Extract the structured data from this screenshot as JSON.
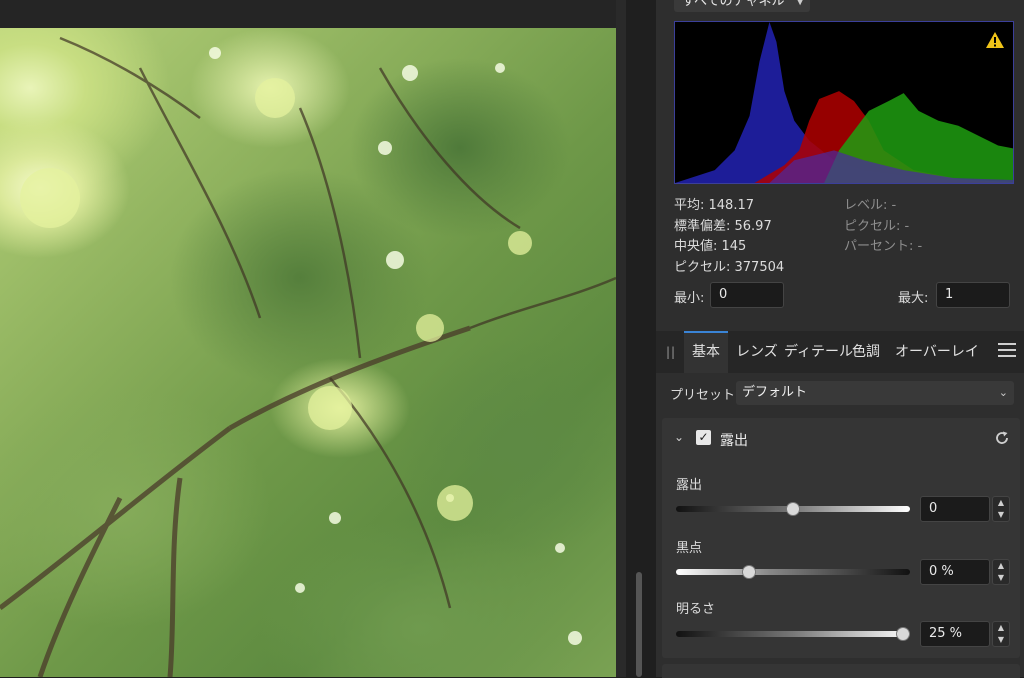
{
  "histogram": {
    "channel": "すべてのチャネル",
    "stats": {
      "mean": "平均: 148.17",
      "std_dev": "標準偏差: 56.97",
      "median": "中央値: 145",
      "pixels": "ピクセル: 377504",
      "level": "レベル: -",
      "pixel_at": "ピクセル: -",
      "percent": "パーセント: -"
    },
    "min_label": "最小:",
    "min_value": "0",
    "max_label": "最大:",
    "max_value": "1"
  },
  "tabs": [
    {
      "label": "基本"
    },
    {
      "label": "レンズ"
    },
    {
      "label": "ディテール"
    },
    {
      "label": "色調"
    },
    {
      "label": "オーバーレイ"
    }
  ],
  "preset": {
    "label": "プリセット:",
    "value": "デフォルト"
  },
  "exposure_group": {
    "title": "露出",
    "sliders": [
      {
        "label": "露出",
        "value": "0",
        "level": 0.5
      },
      {
        "label": "黒点",
        "value": "0 %",
        "level": 0.3
      },
      {
        "label": "明るさ",
        "value": "25 %",
        "level": 1.0
      }
    ]
  },
  "colors": {
    "accent": "#3a84d6",
    "warning": "#f0c419"
  }
}
